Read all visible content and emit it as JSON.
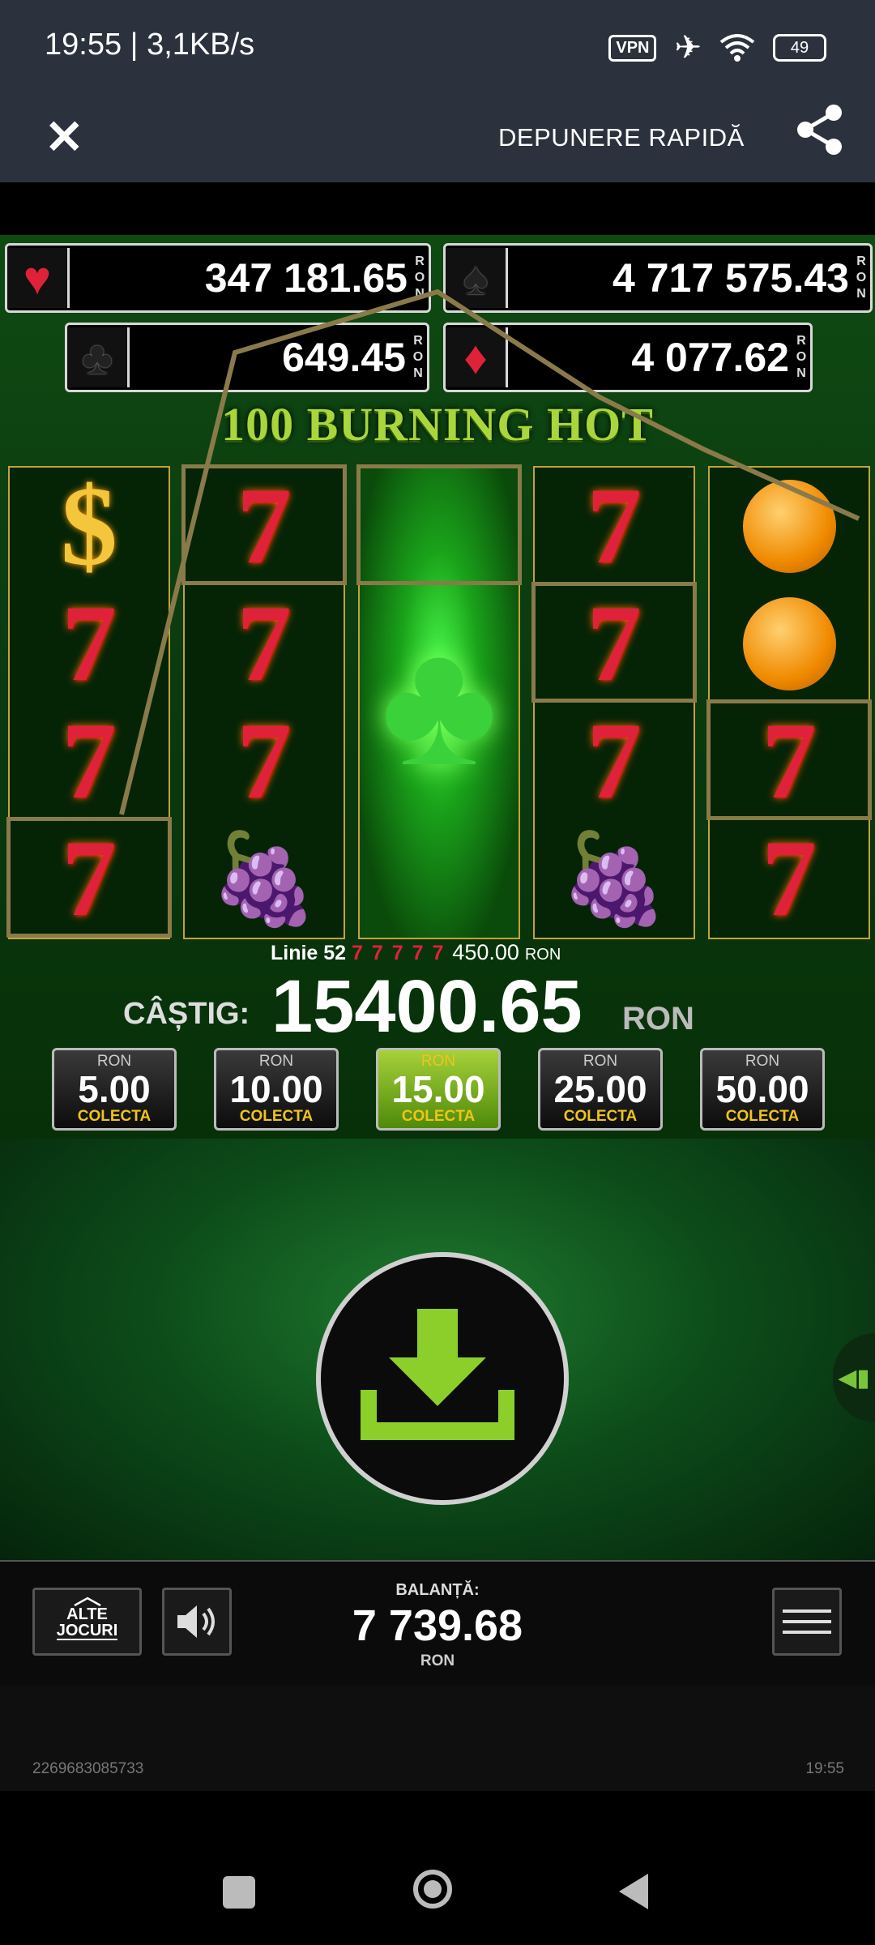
{
  "status_bar": {
    "time_speed": "19:55 | 3,1KB/s",
    "vpn": "VPN",
    "battery": "49"
  },
  "top_bar": {
    "deposit_label": "DEPUNERE RAPIDĂ"
  },
  "jackpots": [
    {
      "suit": "hearts",
      "value": "347 181.65",
      "currency": "RON",
      "color": "#e0213a"
    },
    {
      "suit": "spades",
      "value": "4 717 575.43",
      "currency": "RON",
      "color": "#111111"
    },
    {
      "suit": "clubs",
      "value": "649.45",
      "currency": "RON",
      "color": "#111111"
    },
    {
      "suit": "diamonds",
      "value": "4 077.62",
      "currency": "RON",
      "color": "#e0213a"
    }
  ],
  "game_title": "100 BURNING HOT",
  "reels": [
    [
      "dollar",
      "seven",
      "seven",
      "seven"
    ],
    [
      "seven",
      "seven",
      "seven",
      "grapes"
    ],
    [
      "clover-wild"
    ],
    [
      "seven",
      "seven",
      "seven",
      "grapes"
    ],
    [
      "orange",
      "orange",
      "seven",
      "seven"
    ]
  ],
  "win_line": {
    "label": "Linie 52",
    "amount": "450.00",
    "currency": "RON"
  },
  "win": {
    "label": "CÂȘTIG:",
    "amount": "15400.65",
    "currency": "RON"
  },
  "collect_options": [
    {
      "currency": "RON",
      "amount": "5.00",
      "label": "COLECTA",
      "selected": false
    },
    {
      "currency": "RON",
      "amount": "10.00",
      "label": "COLECTA",
      "selected": false
    },
    {
      "currency": "RON",
      "amount": "15.00",
      "label": "COLECTA",
      "selected": true
    },
    {
      "currency": "RON",
      "amount": "25.00",
      "label": "COLECTA",
      "selected": false
    },
    {
      "currency": "RON",
      "amount": "50.00",
      "label": "COLECTA",
      "selected": false
    }
  ],
  "bottom_bar": {
    "other_games_line1": "ALTE",
    "other_games_line2": "JOCURI",
    "balance_label": "BALANȚĂ:",
    "balance_value": "7 739.68",
    "balance_currency": "RON"
  },
  "footer": {
    "session_id": "2269683085733",
    "time": "19:55"
  },
  "colors": {
    "accent_green": "#a6d13a",
    "collect_label": "#f0c419",
    "reel_border": "#c2a23a"
  }
}
